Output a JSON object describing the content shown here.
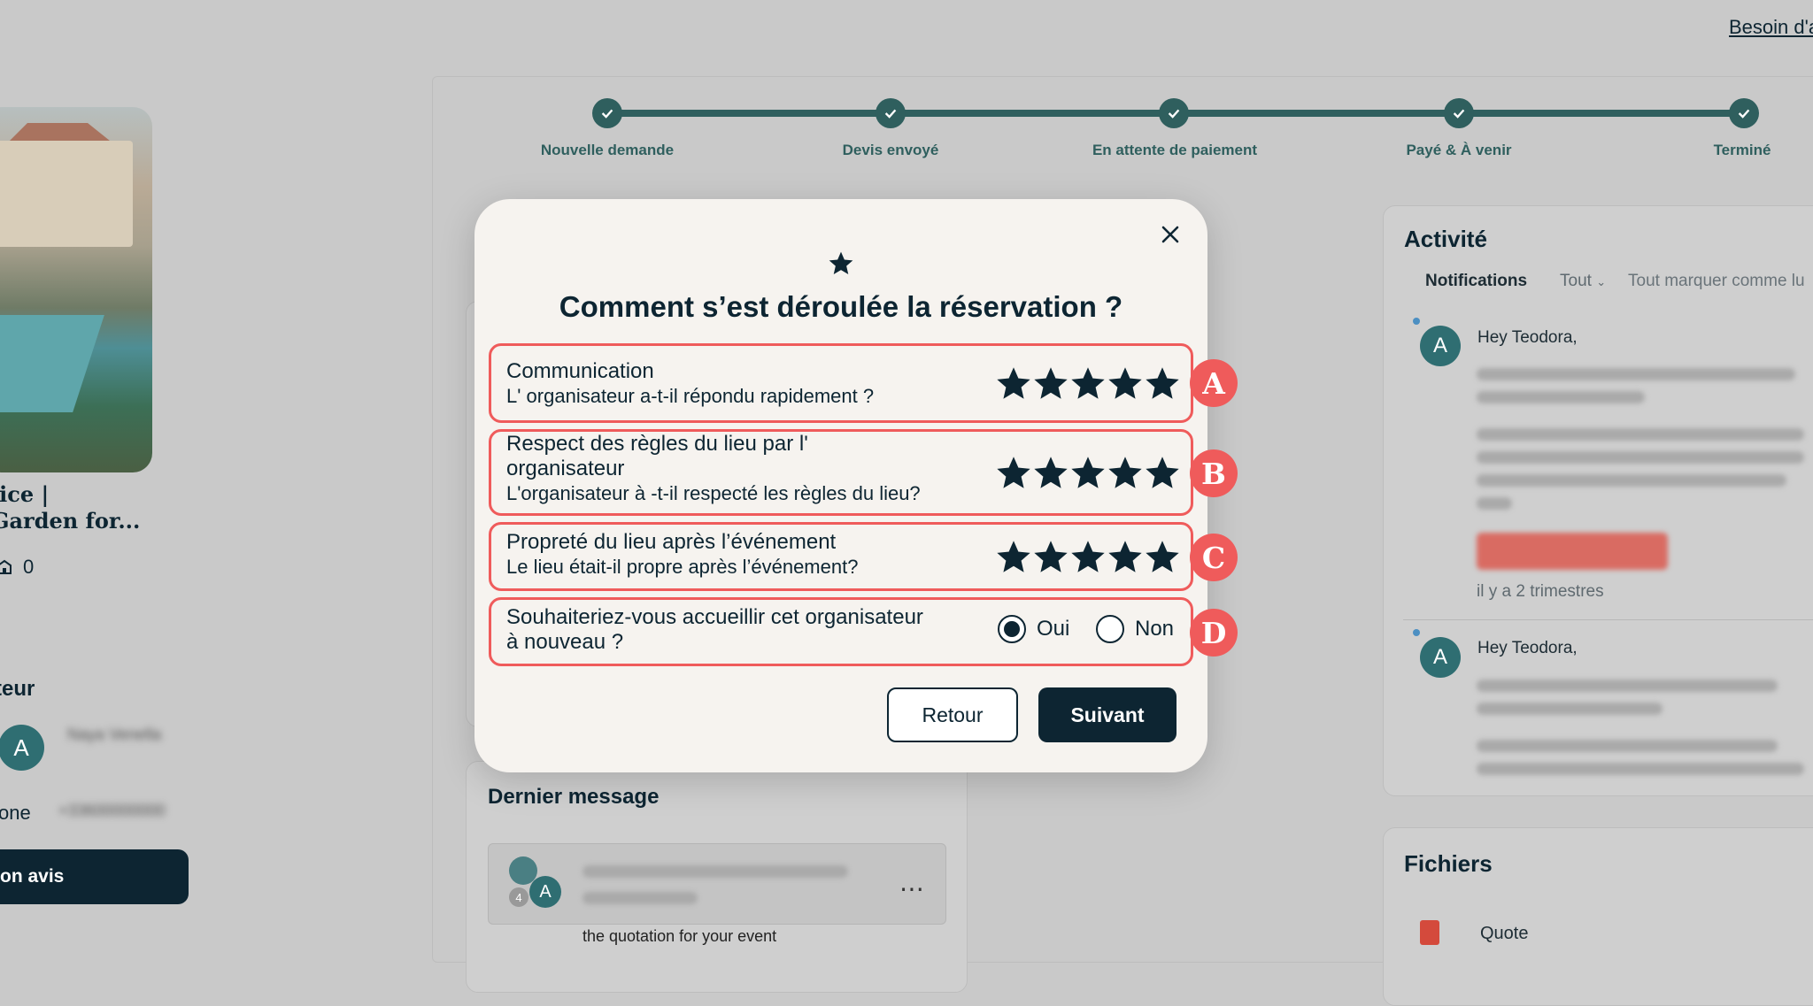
{
  "header": {
    "help_link": "Besoin d'a"
  },
  "stepper": {
    "steps": [
      "Nouvelle demande",
      "Devis envoyé",
      "En attente de paiement",
      "Payé & À venir",
      "Terminé"
    ],
    "color": "#2f5f5e"
  },
  "venue": {
    "title_line1": "lice |",
    "title_line2": "Garden for...",
    "count": "0"
  },
  "organizer": {
    "title": "teur",
    "avatar": "A",
    "name": "Naya Venella",
    "phone_label": "one",
    "phone_value": "+33600000000",
    "review_button": "on avis"
  },
  "last_message": {
    "title": "Dernier message",
    "avatar": "A",
    "count": "4",
    "snippet": "the quotation for your event"
  },
  "activity": {
    "title": "Activité",
    "tabs": [
      "Notifications",
      "Tout",
      "Tout marquer comme lu"
    ],
    "items": [
      {
        "avatar": "A",
        "greeting": "Hey Teodora,",
        "time": "il y a 2 trimestres"
      },
      {
        "avatar": "A",
        "greeting": "Hey Teodora,"
      }
    ]
  },
  "files": {
    "title": "Fichiers",
    "items": [
      "Quote"
    ]
  },
  "modal": {
    "title": "Comment s’est déroulée la réservation ?",
    "questions": [
      {
        "badge": "A",
        "title": "Communication",
        "subtitle": "L' organisateur a-t-il répondu rapidement ?",
        "rating": 5,
        "max": 5
      },
      {
        "badge": "B",
        "title_line1": "Respect des règles du lieu par l'",
        "title_line2": "organisateur",
        "subtitle": "L'organisateur à -t-il respecté les règles du lieu?",
        "rating": 5,
        "max": 5
      },
      {
        "badge": "C",
        "title": "Propreté du lieu après l’événement",
        "subtitle": "Le lieu était-il propre après l’événement?",
        "rating": 5,
        "max": 5
      },
      {
        "badge": "D",
        "title_line1": "Souhaiteriez-vous accueillir cet organisateur",
        "title_line2": "à nouveau ?",
        "options": [
          "Oui",
          "Non"
        ],
        "selected": "Oui"
      }
    ],
    "back_button": "Retour",
    "next_button": "Suivant",
    "accent": "#ef5b5b",
    "primary": "#0d2532"
  }
}
